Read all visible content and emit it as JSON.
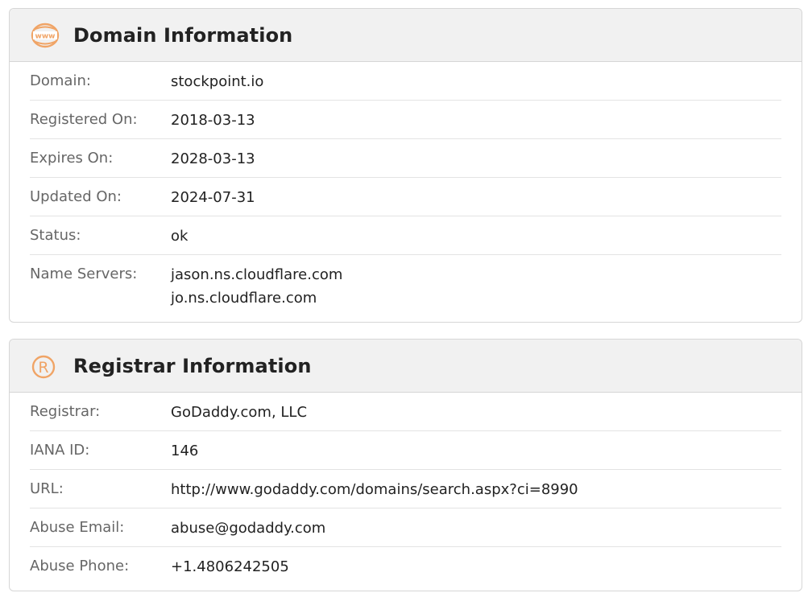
{
  "domain_card": {
    "title": "Domain Information",
    "icon": "www-globe-icon",
    "rows": [
      {
        "label": "Domain:",
        "value": "stockpoint.io"
      },
      {
        "label": "Registered On:",
        "value": "2018-03-13"
      },
      {
        "label": "Expires On:",
        "value": "2028-03-13"
      },
      {
        "label": "Updated On:",
        "value": "2024-07-31"
      },
      {
        "label": "Status:",
        "value": "ok"
      },
      {
        "label": "Name Servers:",
        "values": [
          "jason.ns.cloudflare.com",
          "jo.ns.cloudflare.com"
        ]
      }
    ]
  },
  "registrar_card": {
    "title": "Registrar Information",
    "icon": "registered-trademark-icon",
    "rows": [
      {
        "label": "Registrar:",
        "value": "GoDaddy.com, LLC"
      },
      {
        "label": "IANA ID:",
        "value": "146"
      },
      {
        "label": "URL:",
        "value": "http://www.godaddy.com/domains/search.aspx?ci=8990"
      },
      {
        "label": "Abuse Email:",
        "value": "abuse@godaddy.com"
      },
      {
        "label": "Abuse Phone:",
        "value": "+1.4806242505"
      }
    ]
  },
  "colors": {
    "accent": "#f0a466",
    "header_bg": "#f1f1f1",
    "border": "#d6d6d6",
    "label_text": "#666666",
    "value_text": "#222222"
  }
}
